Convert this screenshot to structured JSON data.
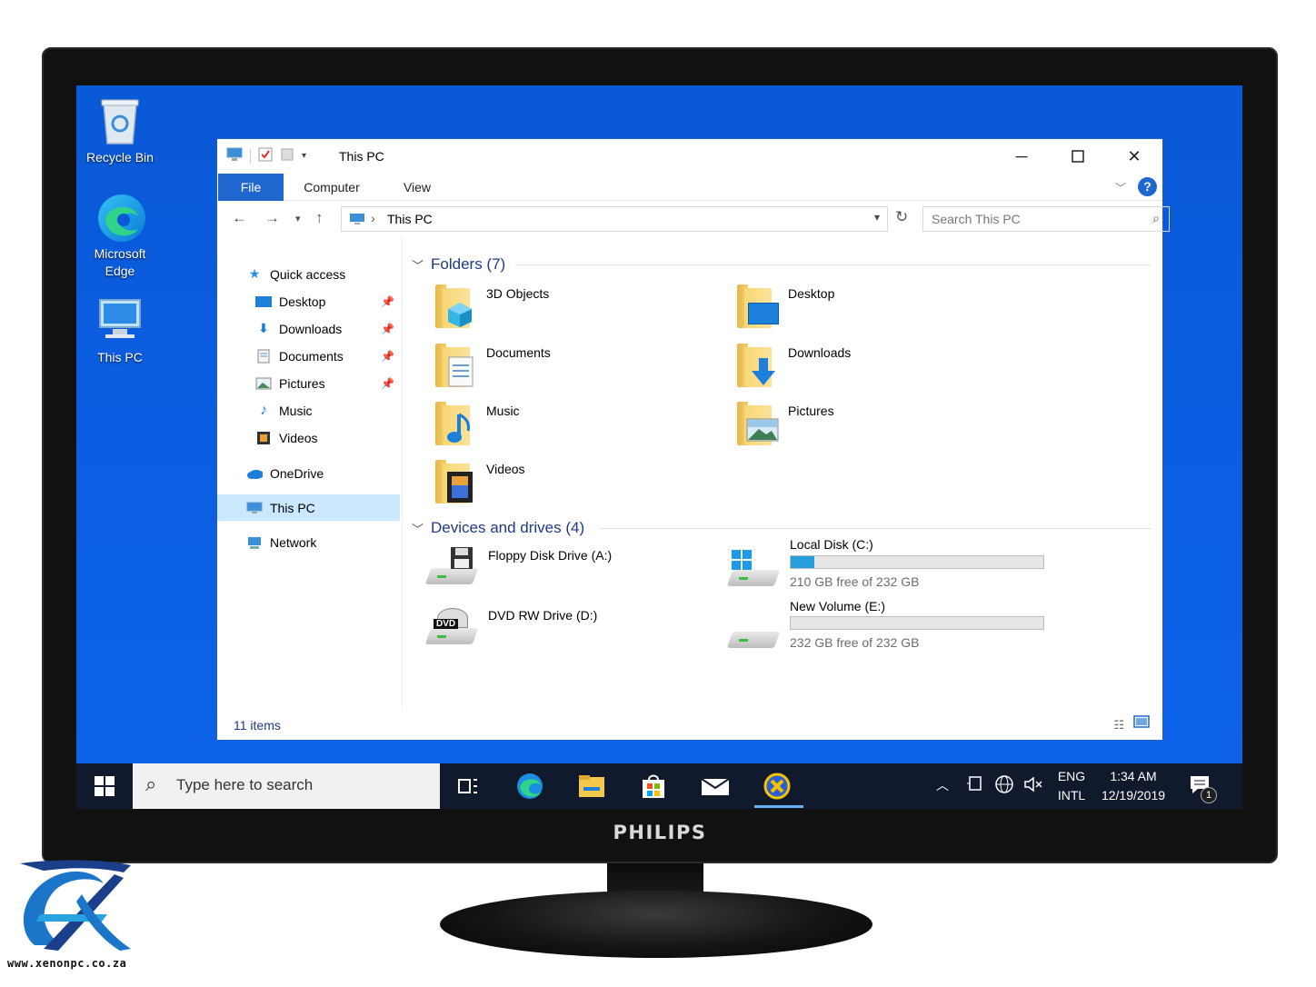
{
  "desktop": {
    "icons": [
      {
        "label": "Recycle Bin"
      },
      {
        "label": "Microsoft Edge"
      },
      {
        "label": "This PC"
      }
    ]
  },
  "window": {
    "title": "This PC",
    "ribbon_tabs": [
      "File",
      "Computer",
      "View"
    ],
    "help_label": "?",
    "address": "This PC",
    "search_placeholder": "Search This PC",
    "nav": {
      "quick_access": "Quick access",
      "items": [
        "Desktop",
        "Downloads",
        "Documents",
        "Pictures",
        "Music",
        "Videos"
      ],
      "onedrive": "OneDrive",
      "this_pc": "This PC",
      "network": "Network"
    },
    "folders_header": "Folders (7)",
    "folders": [
      "3D Objects",
      "Desktop",
      "Documents",
      "Downloads",
      "Music",
      "Pictures",
      "Videos"
    ],
    "devices_header": "Devices and drives (4)",
    "drives": [
      {
        "name": "Floppy Disk Drive (A:)"
      },
      {
        "name": "Local Disk (C:)",
        "free": "210 GB free of 232 GB",
        "used_fraction": 0.095
      },
      {
        "name": "DVD RW Drive (D:)",
        "badge": "DVD"
      },
      {
        "name": "New Volume (E:)",
        "free": "232 GB free of 232 GB",
        "used_fraction": 0.0
      }
    ],
    "status": "11 items"
  },
  "taskbar": {
    "search_placeholder": "Type here to search",
    "lang_top": "ENG",
    "lang_bottom": "INTL",
    "time": "1:34 AM",
    "date": "12/19/2019",
    "notification_count": "1"
  },
  "monitor_brand": "PHILIPS",
  "watermark_url": "www.xenonpc.co.za",
  "colors": {
    "desktop": "#0b5de0",
    "accent": "#1f66cf",
    "taskbar": "#101a2c",
    "selection": "#cce8ff",
    "disk_fill": "#26a0da"
  }
}
